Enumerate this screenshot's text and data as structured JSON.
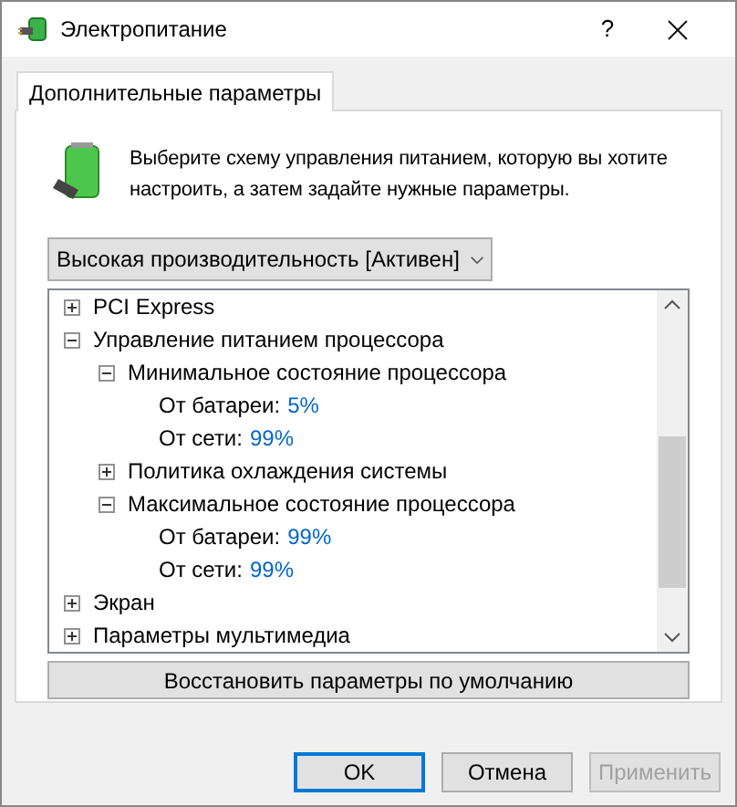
{
  "window": {
    "title": "Электропитание",
    "help": "?"
  },
  "tabs": [
    {
      "label": "Дополнительные параметры",
      "selected": true
    }
  ],
  "description": "Выберите схему управления питанием, которую вы хотите настроить, а затем задайте нужные параметры.",
  "plan_dropdown": {
    "value": "Высокая производительность [Активен]"
  },
  "tree": [
    {
      "kind": "group",
      "label": "PCI Express",
      "expanded": false
    },
    {
      "kind": "group",
      "label": "Управление питанием процессора",
      "expanded": true,
      "children": [
        {
          "kind": "group",
          "label": "Минимальное состояние процессора",
          "expanded": true,
          "children": [
            {
              "kind": "setting",
              "label": "От батареи:",
              "value": "5%"
            },
            {
              "kind": "setting",
              "label": "От сети:",
              "value": "99%"
            }
          ]
        },
        {
          "kind": "group",
          "label": "Политика охлаждения системы",
          "expanded": false
        },
        {
          "kind": "group",
          "label": "Максимальное состояние процессора",
          "expanded": true,
          "children": [
            {
              "kind": "setting",
              "label": "От батареи:",
              "value": "99%"
            },
            {
              "kind": "setting",
              "label": "От сети:",
              "value": "99%"
            }
          ]
        }
      ]
    },
    {
      "kind": "group",
      "label": "Экран",
      "expanded": false
    },
    {
      "kind": "group",
      "label": "Параметры мультимедиа",
      "expanded": false
    }
  ],
  "restore_button": "Восстановить параметры по умолчанию",
  "buttons": [
    {
      "label": "OK",
      "default": true,
      "disabled": false
    },
    {
      "label": "Отмена",
      "default": false,
      "disabled": false
    },
    {
      "label": "Применить",
      "default": false,
      "disabled": true
    }
  ]
}
